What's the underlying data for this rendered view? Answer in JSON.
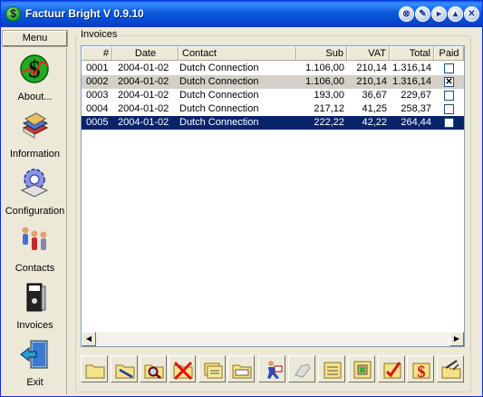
{
  "window": {
    "title": "Factuur Bright V 0.9.10",
    "controls": [
      "⊗",
      "✎",
      "▸",
      "▴",
      "✕"
    ]
  },
  "menu": {
    "header": "Menu",
    "items": [
      {
        "label": "About...",
        "icon": "dollar-icon"
      },
      {
        "label": "Information",
        "icon": "books-icon"
      },
      {
        "label": "Configuration",
        "icon": "gear-icon"
      },
      {
        "label": "Contacts",
        "icon": "people-icon"
      },
      {
        "label": "Invoices",
        "icon": "binder-icon"
      },
      {
        "label": "Exit",
        "icon": "exit-door-icon"
      }
    ]
  },
  "invoices": {
    "group_label": "Invoices",
    "columns": [
      "#",
      "Date",
      "Contact",
      "Sub",
      "VAT",
      "Total",
      "Paid"
    ],
    "rows": [
      {
        "num": "0001",
        "date": "2004-01-02",
        "contact": "Dutch Connection",
        "sub": "1.106,00",
        "vat": "210,14",
        "total": "1.316,14",
        "paid": false
      },
      {
        "num": "0002",
        "date": "2004-01-02",
        "contact": "Dutch Connection",
        "sub": "1.106,00",
        "vat": "210,14",
        "total": "1.316,14",
        "paid": true
      },
      {
        "num": "0003",
        "date": "2004-01-02",
        "contact": "Dutch Connection",
        "sub": "193,00",
        "vat": "36,67",
        "total": "229,67",
        "paid": false
      },
      {
        "num": "0004",
        "date": "2004-01-02",
        "contact": "Dutch Connection",
        "sub": "217,12",
        "vat": "41,25",
        "total": "258,37",
        "paid": false
      },
      {
        "num": "0005",
        "date": "2004-01-02",
        "contact": "Dutch Connection",
        "sub": "222,22",
        "vat": "42,22",
        "total": "264,44",
        "paid": false
      }
    ],
    "selected_row": 4
  },
  "toolbar": {
    "buttons": [
      "new-invoice-icon",
      "edit-invoice-icon",
      "search-invoice-icon",
      "delete-invoice-icon",
      "copy-invoice-icon",
      "invoice-list-icon",
      "send-invoice-icon",
      "pay-invoice-icon",
      "document-icon",
      "print-icon",
      "mark-paid-icon",
      "currency-icon",
      "invoice-options-icon"
    ]
  },
  "colors": {
    "titlebar": "#0b5bdc",
    "selection": "#0a246a",
    "window_bg": "#ece9d8"
  }
}
